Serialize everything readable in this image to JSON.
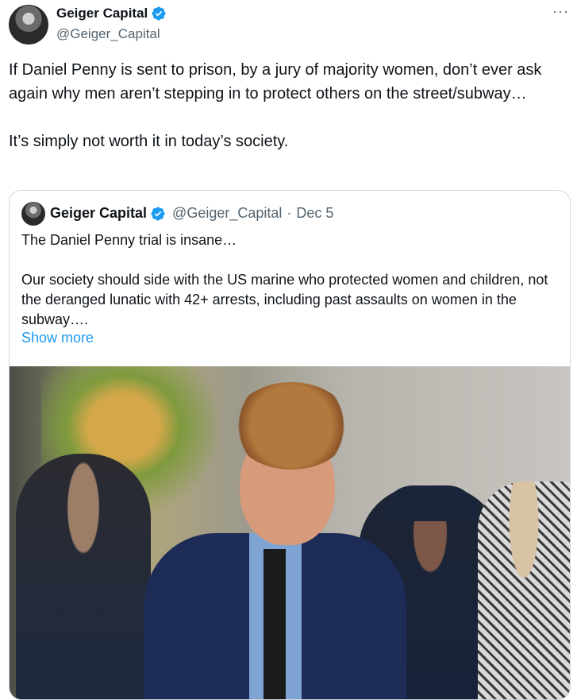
{
  "tweet": {
    "display_name": "Geiger Capital",
    "handle": "@Geiger_Capital",
    "more_label": "···",
    "text": "If Daniel Penny is sent to prison, by a jury of majority women, don’t ever ask again why men aren’t stepping in to protect others on the street/subway…\n\nIt’s simply not worth it in today’s society."
  },
  "quote": {
    "display_name": "Geiger Capital",
    "handle": "@Geiger_Capital",
    "separator": "·",
    "date": "Dec 5",
    "text": "The Daniel Penny trial is insane…\n\nOur society should side with the US marine who protected women and children, not the deranged lunatic with 42+ arrests, including past assaults on women in the subway….",
    "show_more": "Show more"
  },
  "colors": {
    "verified": "#1d9bf0",
    "link": "#1d9bf0",
    "muted": "#536471",
    "text": "#0f1419"
  },
  "icons": {
    "verified": "verified-badge-icon",
    "more": "more-horizontal-icon"
  }
}
